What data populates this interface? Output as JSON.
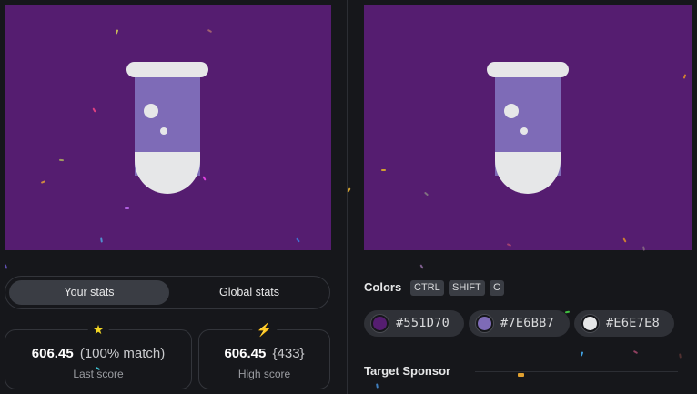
{
  "target_image": {
    "background_color": "#551D70",
    "flask_body_color": "#7E6BB7",
    "flask_light_color": "#E6E7E8",
    "description_icon": "test-tube-icon"
  },
  "stats_toggle": {
    "your_stats_label": "Your stats",
    "global_stats_label": "Global stats"
  },
  "stats": {
    "last": {
      "icon": "star-icon",
      "score": "606.45",
      "match": "(100% match)",
      "label": "Last score"
    },
    "high": {
      "icon": "lightning-icon",
      "score": "606.45",
      "extra": "{433}",
      "label": "High score"
    }
  },
  "colors_section": {
    "title": "Colors",
    "shortcut_keys": [
      "CTRL",
      "SHIFT",
      "C"
    ],
    "swatches": [
      {
        "hex": "#551D70",
        "color": "#551D70"
      },
      {
        "hex": "#7E6BB7",
        "color": "#7E6BB7"
      },
      {
        "hex": "#E6E7E8",
        "color": "#E6E7E8"
      }
    ]
  },
  "sponsor_section": {
    "title": "Target Sponsor"
  }
}
